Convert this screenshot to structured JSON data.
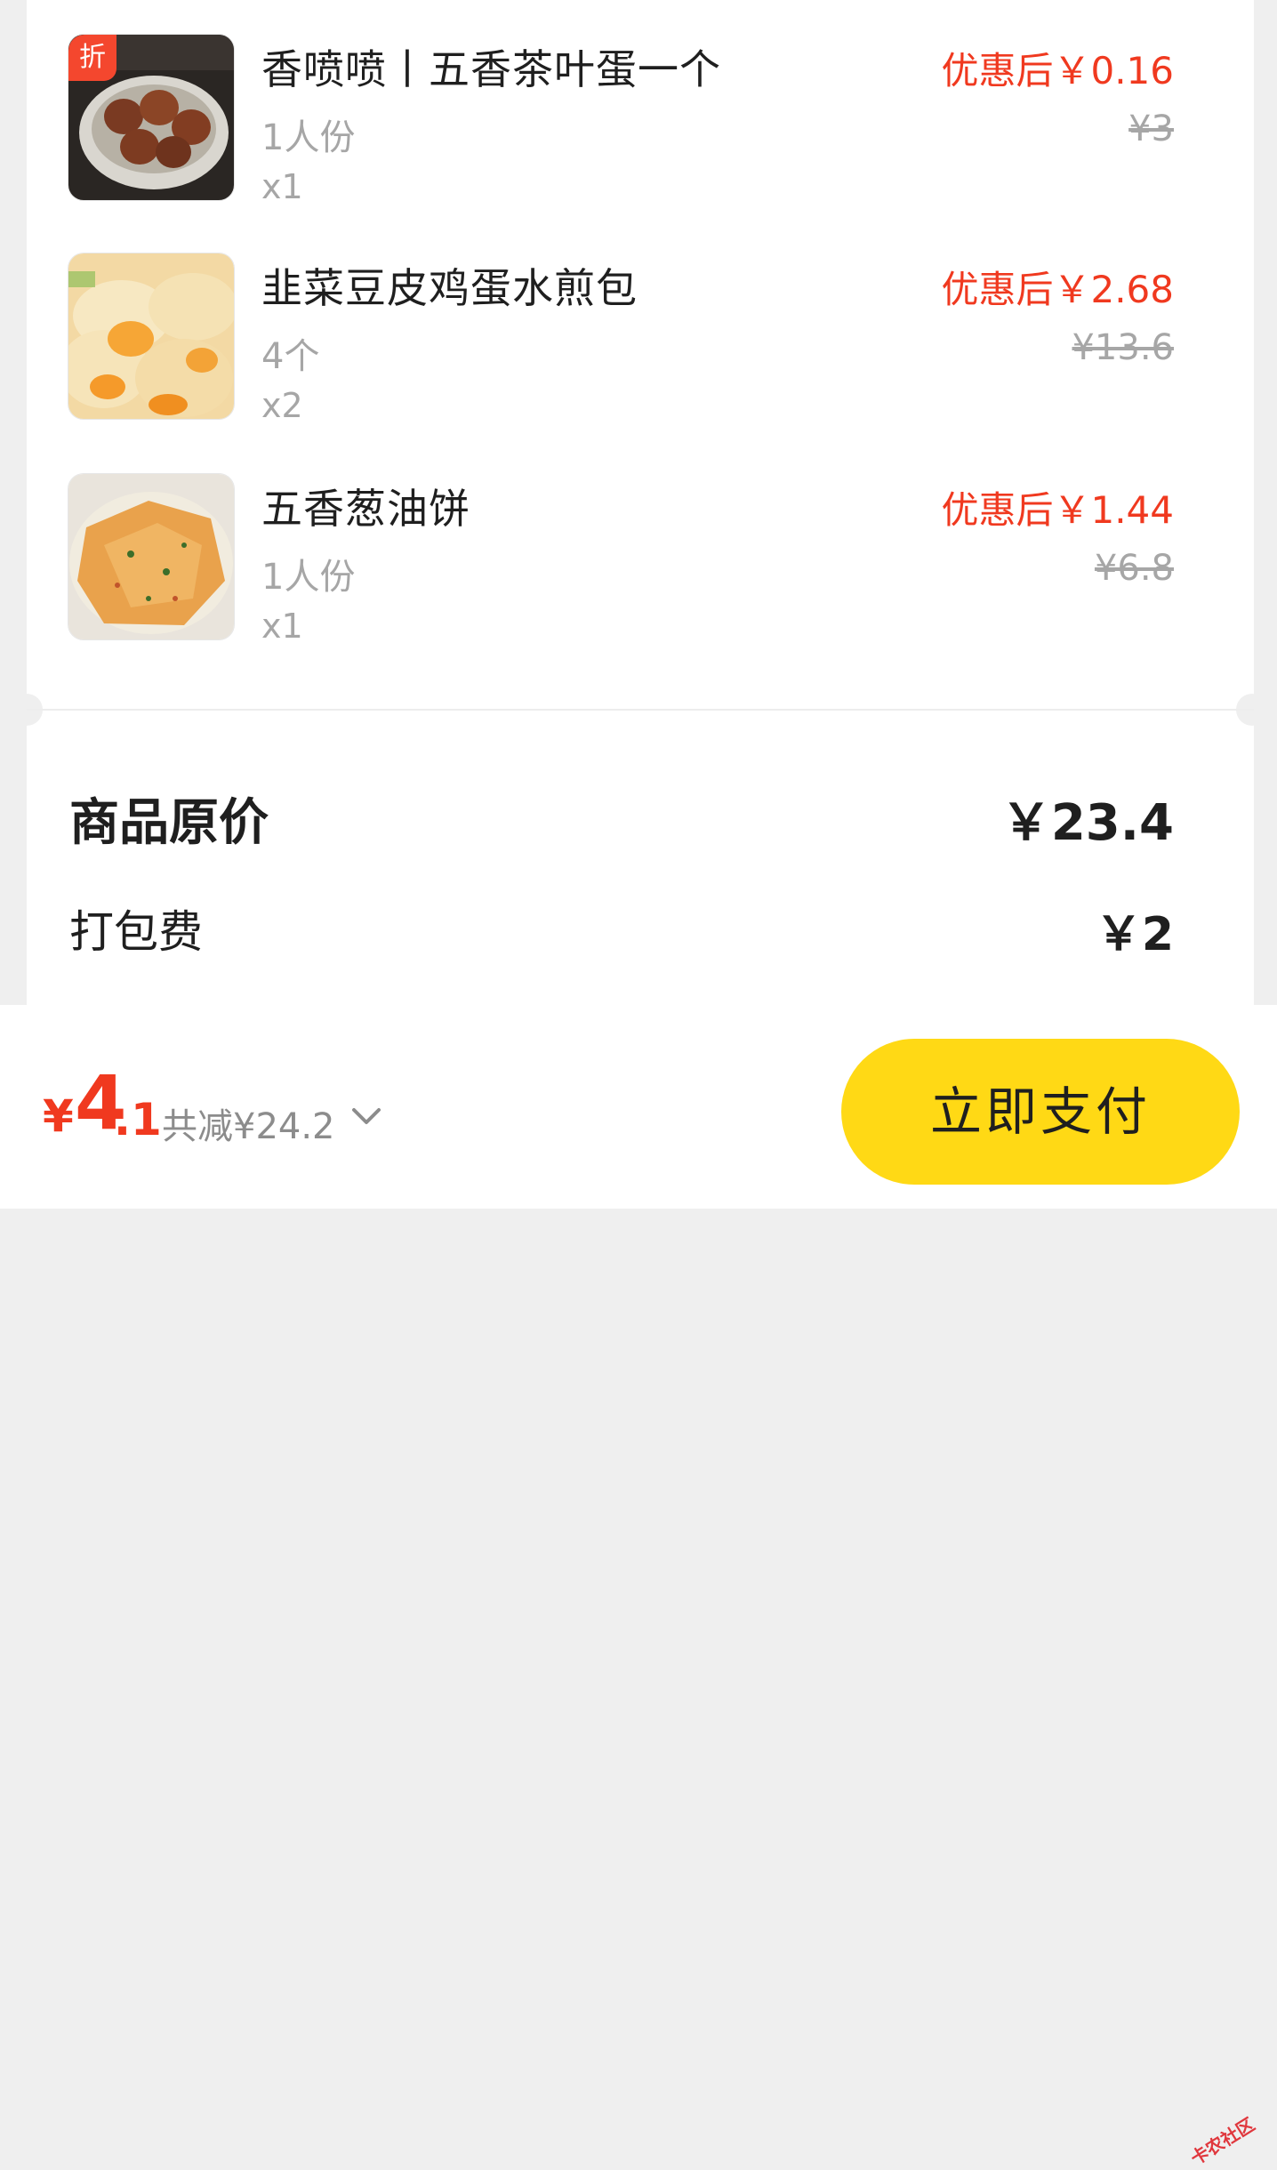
{
  "items": [
    {
      "name": "香喷喷丨五香茶叶蛋一个",
      "spec": "1人份",
      "qty": "x1",
      "price_after": "优惠后￥0.16",
      "price_orig": "¥3",
      "badge": "折"
    },
    {
      "name": "韭菜豆皮鸡蛋水煎包",
      "spec": "4个",
      "qty": "x2",
      "price_after": "优惠后￥2.68",
      "price_orig": "¥13.6"
    },
    {
      "name": "五香葱油饼",
      "spec": "1人份",
      "qty": "x1",
      "price_after": "优惠后￥1.44",
      "price_orig": "¥6.8"
    }
  ],
  "summary": {
    "original_label": "商品原价",
    "original_value": "￥23.4",
    "packing_label": "打包费",
    "packing_value": "￥2"
  },
  "footer": {
    "total_symbol": "¥",
    "total_int": "4",
    "total_dec": ".1",
    "saved_text": "共减¥24.2",
    "expand_icon": "chevron-down-icon",
    "pay_label": "立即支付"
  },
  "watermark": "卡农社区",
  "colors": {
    "accent_red": "#f0391f",
    "pay_yellow": "#ffd915",
    "muted": "#a6a6a6"
  }
}
